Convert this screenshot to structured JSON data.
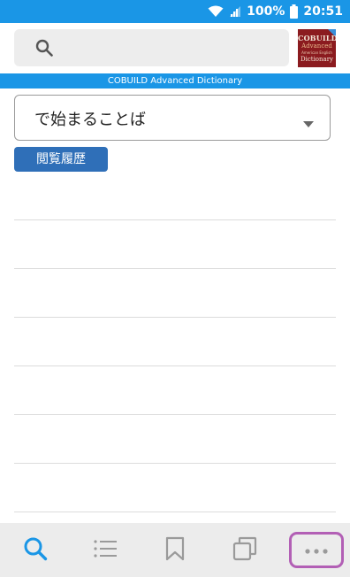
{
  "status_bar": {
    "battery_percent": "100%",
    "time": "20:51",
    "icons": [
      "wifi-icon",
      "signal-icon",
      "battery-icon"
    ]
  },
  "search": {
    "placeholder": "",
    "value": "",
    "icon": "search-icon"
  },
  "book_cover": {
    "line1": "COBUILD",
    "line2": "Advanced",
    "line3": "American English",
    "line4": "Dictionary"
  },
  "dictionary_banner": "COBUILD Advanced Dictionary",
  "filter": {
    "selected": "で始まることば"
  },
  "history_button": "閲覧履歴",
  "list_items": [
    "",
    "",
    "",
    "",
    "",
    "",
    ""
  ],
  "bottom_nav": {
    "items": [
      "search-icon",
      "list-icon",
      "bookmark-icon",
      "copy-icon",
      "more-icon"
    ],
    "active": "search-icon"
  },
  "colors": {
    "accent": "#1a96e6",
    "button": "#2f6fb8",
    "highlight": "#b25fb5",
    "book": "#8b1b1f"
  }
}
